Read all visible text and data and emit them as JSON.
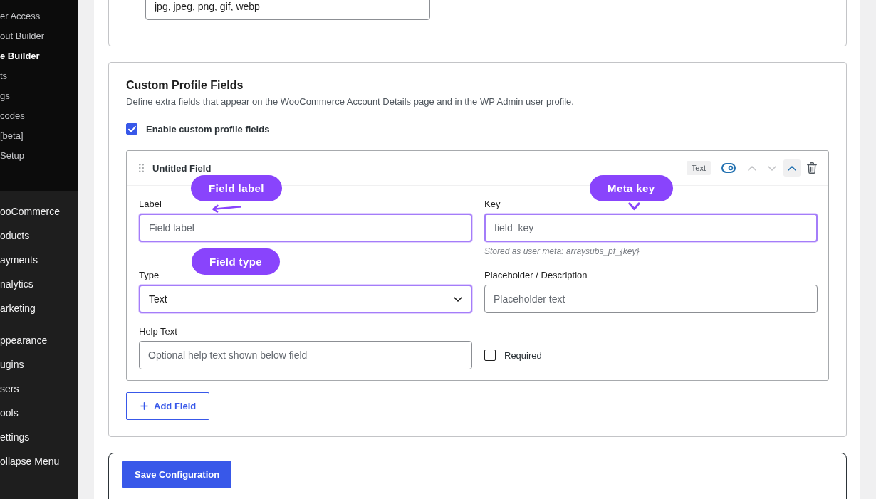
{
  "sidebar": {
    "submenu": [
      {
        "label": "er Access",
        "selected": false
      },
      {
        "label": "out Builder",
        "selected": false
      },
      {
        "label": "e Builder",
        "selected": true
      },
      {
        "label": "ts",
        "selected": false
      },
      {
        "label": "gs",
        "selected": false
      },
      {
        "label": "codes",
        "selected": false
      },
      {
        "label": "[beta]",
        "selected": false
      },
      {
        "label": "Setup",
        "selected": false
      }
    ],
    "menu_groups": [
      {
        "items": [
          {
            "label": "ooCommerce"
          },
          {
            "label": "oducts"
          },
          {
            "label": "ayments"
          },
          {
            "label": "nalytics"
          },
          {
            "label": "arketing"
          }
        ]
      },
      {
        "items": [
          {
            "label": "ppearance"
          },
          {
            "label": "ugins"
          },
          {
            "label": "sers"
          },
          {
            "label": "ools"
          },
          {
            "label": "ettings"
          },
          {
            "label": "ollapse Menu"
          }
        ]
      }
    ]
  },
  "upper_card": {
    "field_value": "jpg, jpeg, png, gif, webp"
  },
  "profile_fields_card": {
    "title": "Custom Profile Fields",
    "description": "Define extra fields that appear on the WooCommerce Account Details page and in the WP Admin user profile.",
    "enable": {
      "label": "Enable custom profile fields",
      "checked": true
    },
    "fields": [
      {
        "title": "Untitled Field",
        "type_badge": "Text",
        "enabled": true,
        "can_move_up": false,
        "can_move_down": false,
        "expanded": true,
        "inputs": [
          {
            "kind": "text",
            "label": "Label",
            "placeholder": "Field label",
            "highlighted": true,
            "annotation": {
              "text": "Field label",
              "kind": "arrow"
            }
          },
          {
            "kind": "text",
            "label": "Key",
            "placeholder": "field_key",
            "hint": "Stored as user meta: arraysubs_pf_{key}",
            "highlighted": true,
            "annotation": {
              "text": "Meta key",
              "kind": "chevron"
            }
          },
          {
            "kind": "select",
            "label": "Type",
            "value": "Text",
            "highlighted": true,
            "annotation": {
              "text": "Field type",
              "kind": "plain"
            }
          },
          {
            "kind": "text",
            "label": "Placeholder / Description",
            "placeholder": "Placeholder text",
            "highlighted": false
          },
          {
            "kind": "text",
            "label": "Help Text",
            "placeholder": "Optional help text shown below field",
            "highlighted": false
          },
          {
            "kind": "checkbox",
            "label": "Required",
            "checked": false
          }
        ]
      }
    ],
    "add_button": {
      "label": "Add Field"
    }
  },
  "save_button": {
    "label": "Save Configuration"
  }
}
